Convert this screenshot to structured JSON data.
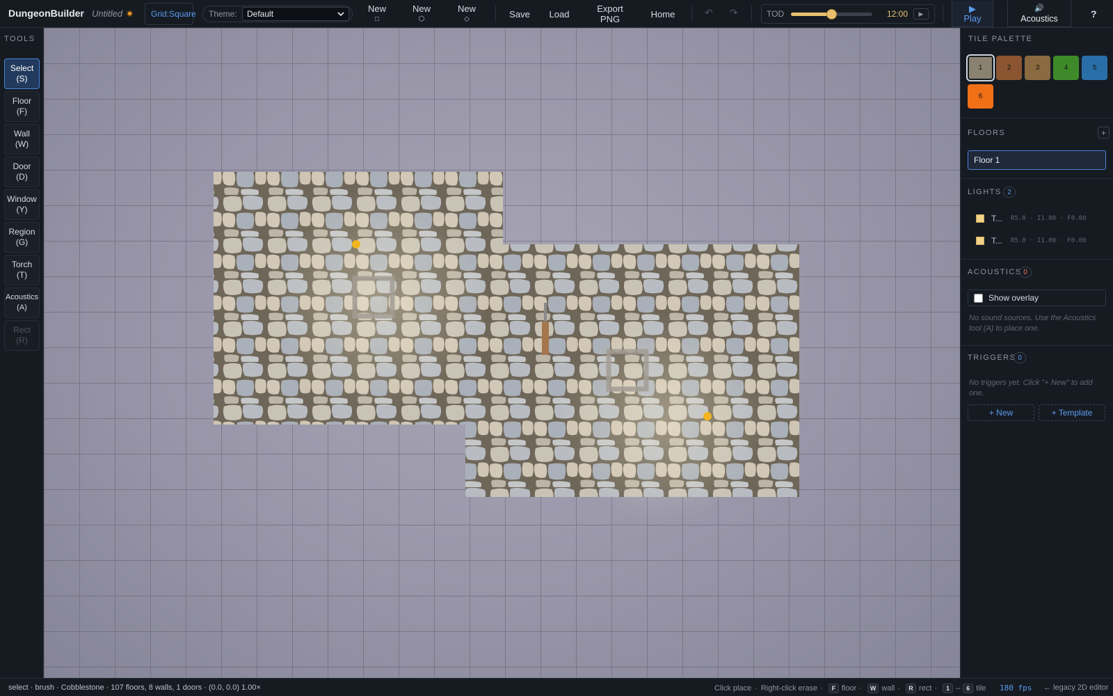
{
  "topbar": {
    "app_title": "DungeonBuilder",
    "separator": "·",
    "doc_title": "Untitled",
    "grid_label": "Grid:",
    "grid_value": "Square",
    "theme_label": "Theme:",
    "theme_value": "Default",
    "new_square_label": "New",
    "new_square_glyph": "□",
    "new_hex_label": "New",
    "new_hex_glyph": "⬡",
    "new_diamond_label": "New",
    "new_diamond_glyph": "◇",
    "save_label": "Save",
    "load_label": "Load",
    "export_label_1": "Export",
    "export_label_2": "PNG",
    "home_label": "Home",
    "undo_glyph": "↶",
    "redo_glyph": "↷",
    "tod_label": "TOD",
    "tod_time": "12:00",
    "tod_level": 0.5,
    "tod_play_glyph": "▶",
    "play_glyph": "▶",
    "play_label": "Play",
    "acoustics_glyph": "🔊",
    "acoustics_label": "Acoustics",
    "help_label": "?"
  },
  "tools": {
    "heading": "TOOLS",
    "items": [
      {
        "name": "Select",
        "key": "(S)"
      },
      {
        "name": "Floor",
        "key": "(F)"
      },
      {
        "name": "Wall",
        "key": "(W)"
      },
      {
        "name": "Door",
        "key": "(D)"
      },
      {
        "name": "Window",
        "key": "(Y)"
      },
      {
        "name": "Region",
        "key": "(G)"
      },
      {
        "name": "Torch",
        "key": "(T)"
      },
      {
        "name": "Acoustics",
        "key": "(A)"
      },
      {
        "name": "Rect",
        "key": "(R)"
      }
    ]
  },
  "panel": {
    "tile_palette_heading": "TILE PALETTE",
    "tiles": [
      {
        "label": "1",
        "color": "#8a8270"
      },
      {
        "label": "2",
        "color": "#8a5530"
      },
      {
        "label": "3",
        "color": "#8a6a40"
      },
      {
        "label": "4",
        "color": "#3e8a2a"
      },
      {
        "label": "5",
        "color": "#2a6ea8"
      },
      {
        "label": "6",
        "color": "#f07018"
      }
    ],
    "floors_heading": "FLOORS",
    "floors_add": "+",
    "floors": [
      "Floor 1"
    ],
    "lights_heading": "LIGHTS",
    "lights_count": "2",
    "lights": [
      {
        "name": "T...",
        "meta": "R5.0 · I1.00 · F0.00"
      },
      {
        "name": "T...",
        "meta": "R5.0 · I1.00 · F0.00"
      }
    ],
    "acoustics_heading": "ACOUSTICS",
    "acoustics_count": "0",
    "show_overlay_label": "Show overlay",
    "acoustics_hint": "No sound sources. Use the Acoustics tool (A) to place one.",
    "triggers_heading": "TRIGGERS",
    "triggers_count": "0",
    "triggers_hint": "No triggers yet. Click \"+ New\" to add one.",
    "new_trigger_label": "+ New",
    "template_label": "+ Template"
  },
  "status": {
    "summary": "select · brush · Cobblestone · 107 floors, 8 walls, 1 doors · (0.0, 0.0) 1.00×",
    "click_place": "Click place",
    "right_click": "Right-click erase",
    "dot": "·",
    "key_floor": "F",
    "floor_word": "floor",
    "key_wall": "W",
    "wall_word": "wall",
    "key_rect": "R",
    "rect_word": "rect",
    "key_from": "1",
    "dash": "–",
    "key_to": "6",
    "tile_word": "tile",
    "fps": "180 fps",
    "legacy_link": "← legacy 2D editor"
  }
}
